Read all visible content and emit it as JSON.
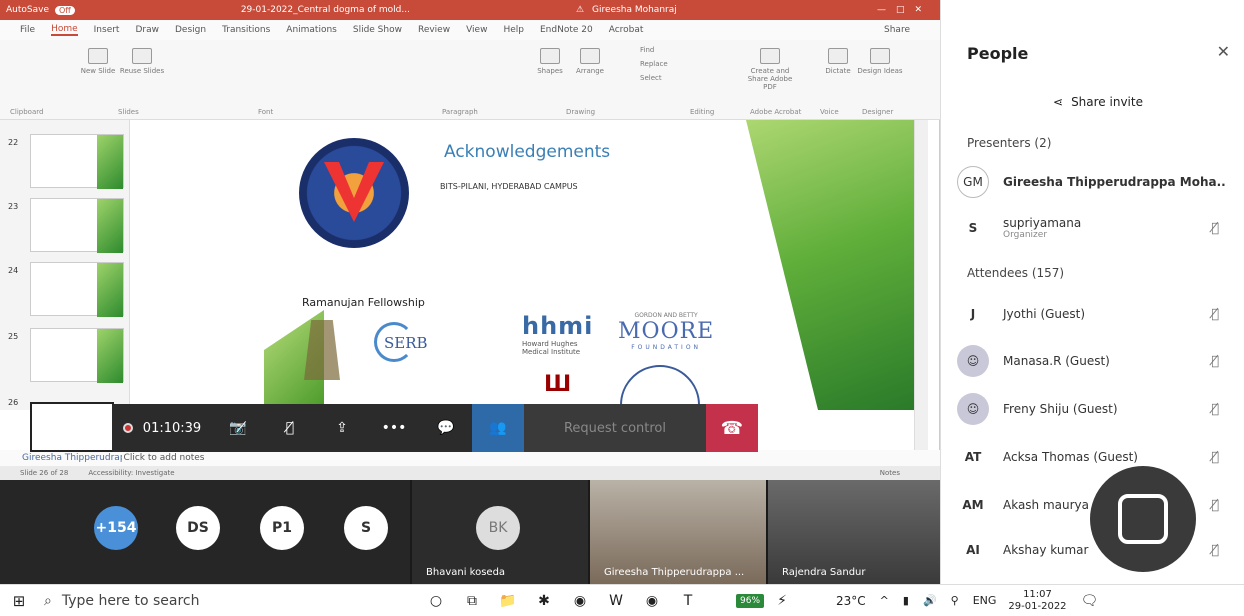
{
  "ppt": {
    "autosave": "AutoSave",
    "autosave_state": "Off",
    "doc_title": "29-01-2022_Central dogma of mold...",
    "warning_icon": "warning-icon",
    "user": "Gireesha Mohanraj",
    "menu": [
      "File",
      "Home",
      "Insert",
      "Draw",
      "Design",
      "Transitions",
      "Animations",
      "Slide Show",
      "Review",
      "View",
      "Help",
      "EndNote 20",
      "Acrobat"
    ],
    "share": "Share",
    "ribbon_groups": [
      "Clipboard",
      "Slides",
      "Font",
      "Paragraph",
      "Drawing",
      "Editing",
      "Adobe Acrobat",
      "Voice",
      "Designer"
    ],
    "ribbon_buttons": [
      "New Slide",
      "Reuse Slides",
      "Shapes",
      "Arrange",
      "Find",
      "Replace",
      "Select",
      "Create and Share Adobe PDF",
      "Dictate",
      "Design Ideas"
    ],
    "slide_numbers": [
      "22",
      "23",
      "24",
      "25",
      "26"
    ],
    "notes_presenter": "Gireesha Thipperudrappa Mohanraj",
    "notes": "Click to add notes",
    "status_left": "Slide 26 of 28",
    "status_access": "Accessibility: Investigate",
    "status_notes": "Notes"
  },
  "slide": {
    "heading": "Acknowledgements",
    "campus": "BITS-PILANI, HYDERABAD CAMPUS",
    "fellowship": "Ramanujan Fellowship",
    "serb": "SERB",
    "hhmi": "hhmi",
    "hhmi_sub1": "Howard Hughes",
    "hhmi_sub2": "Medical Institute",
    "moore_top": "GORDON AND BETTY",
    "moore": "MOORE",
    "moore_bot": "FOUNDATION",
    "iu": "Ш"
  },
  "controls": {
    "timer": "01:10:39",
    "request": "Request control",
    "more": "•••"
  },
  "gallery": {
    "avatars": [
      "+154",
      "DS",
      "P1",
      "S",
      "BK"
    ],
    "names": [
      "Bhavani koseda",
      "Gireesha Thipperudrappa ...",
      "Rajendra Sandur"
    ]
  },
  "people": {
    "title": "People",
    "share_invite": "Share invite",
    "presenters_label": "Presenters (2)",
    "attendees_label": "Attendees (157)",
    "presenters": [
      {
        "initials": "GM",
        "name": "Gireesha Thipperudrappa Moha..",
        "sub": ""
      },
      {
        "initials": "S",
        "name": "supriyamana",
        "sub": "Organizer"
      }
    ],
    "attendees": [
      {
        "initials": "J",
        "name": "Jyothi (Guest)"
      },
      {
        "initials": "",
        "name": "Manasa.R (Guest)"
      },
      {
        "initials": "",
        "name": "Freny Shiju (Guest)"
      },
      {
        "initials": "AT",
        "name": "Acksa Thomas (Guest)"
      },
      {
        "initials": "AM",
        "name": "Akash maurya"
      },
      {
        "initials": "AI",
        "name": "Akshay kumar"
      }
    ]
  },
  "taskbar": {
    "search_placeholder": "Type here to search",
    "battery": "96%",
    "temp": "23°C",
    "lang": "ENG",
    "time": "11:07",
    "date": "29-01-2022"
  },
  "colors": {
    "accent": "#c84a38",
    "teams": "#2e6aa8",
    "hangup": "#c4314b"
  }
}
